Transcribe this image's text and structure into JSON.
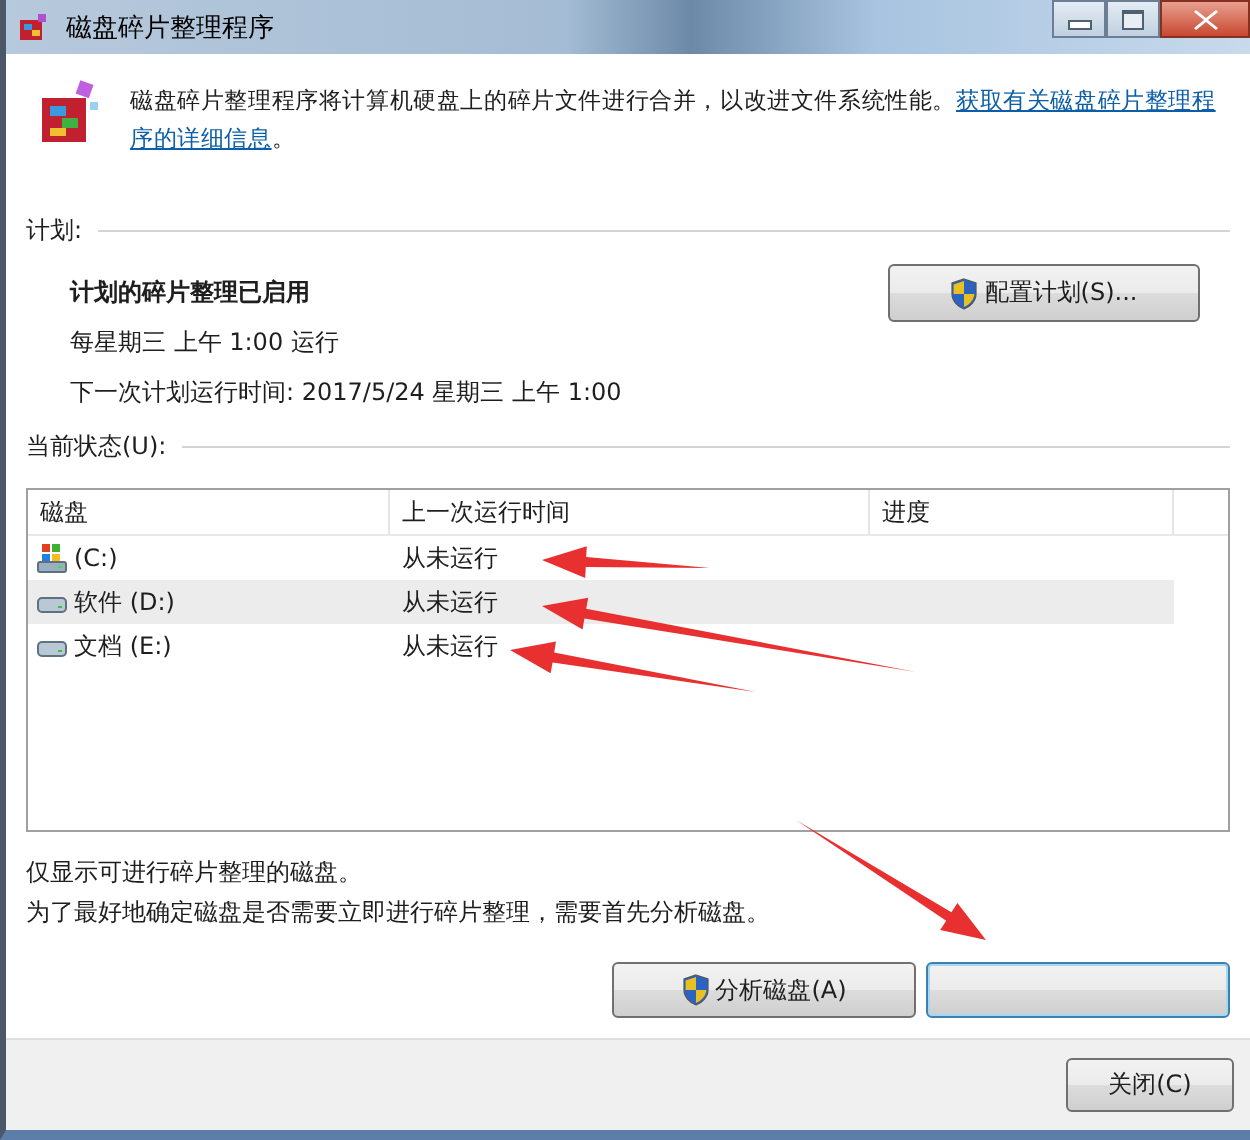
{
  "window": {
    "title": "磁盘碎片整理程序"
  },
  "intro": {
    "text": "磁盘碎片整理程序将计算机硬盘上的碎片文件进行合并，以改进文件系统性能。",
    "link_lines": [
      "获取有关磁盘碎片整理程",
      "序的详细信息"
    ],
    "tail": "。"
  },
  "schedule": {
    "heading": "计划:",
    "status": "计划的碎片整理已启用",
    "frequency": "每星期三  上午 1:00 运行",
    "next_run": "下一次计划运行时间: 2017/5/24 星期三 上午 1:00",
    "button": "配置计划(S)..."
  },
  "current_status": {
    "heading": "当前状态(U):"
  },
  "table": {
    "columns": [
      "磁盘",
      "上一次运行时间",
      "进度"
    ],
    "rows": [
      {
        "kind": "system",
        "disk": "(C:)",
        "last_run": "从未运行",
        "selected": false
      },
      {
        "kind": "drive",
        "disk": "软件 (D:)",
        "last_run": "从未运行",
        "selected": true
      },
      {
        "kind": "drive",
        "disk": "文档 (E:)",
        "last_run": "从未运行",
        "selected": false
      }
    ]
  },
  "notes": [
    "仅显示可进行碎片整理的磁盘。",
    "为了最好地确定磁盘是否需要立即进行碎片整理，需要首先分析磁盘。"
  ],
  "buttons": [
    {
      "kind": "shield",
      "label": "分析磁盘(A)"
    },
    {
      "kind": "blank"
    }
  ],
  "footer": {
    "close_button": "关闭(C)"
  }
}
